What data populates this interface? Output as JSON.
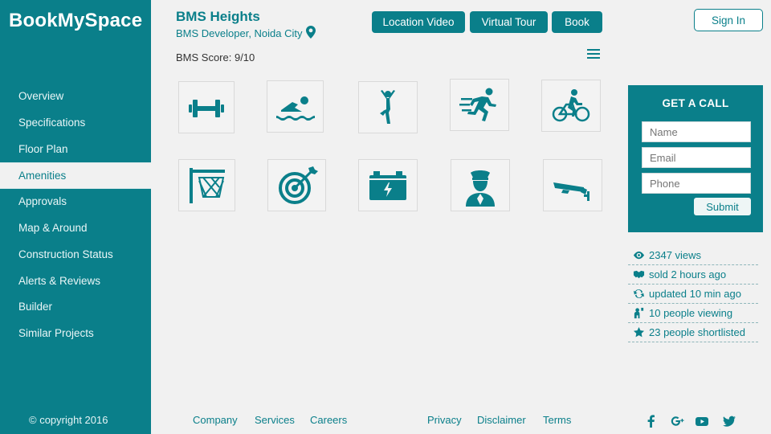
{
  "brand": "BookMySpace",
  "sidebar": {
    "items": [
      {
        "label": "Overview"
      },
      {
        "label": "Specifications"
      },
      {
        "label": "Floor Plan"
      },
      {
        "label": "Amenities"
      },
      {
        "label": "Approvals"
      },
      {
        "label": "Map & Around"
      },
      {
        "label": "Construction Status"
      },
      {
        "label": "Alerts & Reviews"
      },
      {
        "label": "Builder"
      },
      {
        "label": "Similar Projects"
      }
    ],
    "active": "Amenities",
    "copyright": "© copyright 2016"
  },
  "header": {
    "title": "BMS Heights",
    "subtitle": "BMS Developer, Noida City",
    "score": "BMS Score: 9/10",
    "buttons": [
      "Location Video",
      "Virtual Tour",
      "Book"
    ],
    "sign_in": "Sign In"
  },
  "amenities": [
    "gym-icon",
    "swimming-icon",
    "yoga-icon",
    "running-icon",
    "cycling-icon",
    "basketball-icon",
    "target-icon",
    "power-backup-icon",
    "security-guard-icon",
    "cctv-icon"
  ],
  "call_box": {
    "title": "GET A CALL",
    "name_placeholder": "Name",
    "email_placeholder": "Email",
    "phone_placeholder": "Phone",
    "submit": "Submit"
  },
  "stats": [
    {
      "icon": "eye-icon",
      "text": "2347 views"
    },
    {
      "icon": "handshake-icon",
      "text": "sold 2 hours ago"
    },
    {
      "icon": "refresh-icon",
      "text": "updated 10 min ago"
    },
    {
      "icon": "people-icon",
      "text": "10 people viewing"
    },
    {
      "icon": "star-icon",
      "text": "23 people shortlisted"
    }
  ],
  "footer": {
    "links_left": [
      "Company",
      "Services",
      "Careers"
    ],
    "links_right": [
      "Privacy",
      "Disclaimer",
      "Terms"
    ],
    "social": [
      "facebook-icon",
      "google-icon",
      "youtube-icon",
      "twitter-icon"
    ]
  },
  "colors": {
    "accent": "#0a7f8a",
    "background": "#f1f1f1"
  }
}
